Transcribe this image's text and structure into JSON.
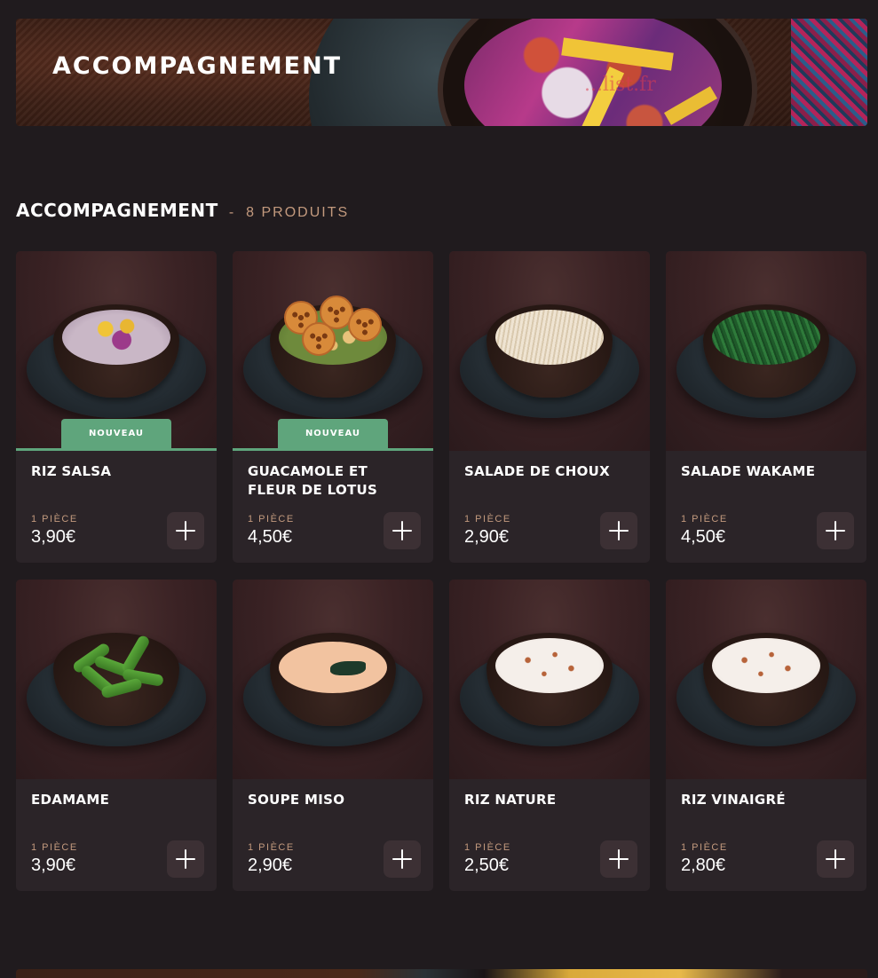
{
  "banner": {
    "title": "ACCOMPAGNEMENT",
    "watermark": "...list.fr"
  },
  "section": {
    "title": "ACCOMPAGNEMENT",
    "separator": "-",
    "count": "8 PRODUITS"
  },
  "colors": {
    "background": "#201b1e",
    "card": "#2b2428",
    "accent_green": "#5fa57c",
    "accent_tan": "#c39a7e",
    "button": "#3c3034"
  },
  "products": [
    {
      "name": "RIZ SALSA",
      "badge": "NOUVEAU",
      "unit": "1 PIÈCE",
      "price": "3,90€",
      "icon": "plus-icon"
    },
    {
      "name": "GUACAMOLE ET FLEUR DE LOTUS",
      "badge": "NOUVEAU",
      "unit": "1 PIÈCE",
      "price": "4,50€",
      "icon": "plus-icon"
    },
    {
      "name": "SALADE DE CHOUX",
      "unit": "1 PIÈCE",
      "price": "2,90€",
      "icon": "plus-icon"
    },
    {
      "name": "SALADE WAKAME",
      "unit": "1 PIÈCE",
      "price": "4,50€",
      "icon": "plus-icon"
    },
    {
      "name": "EDAMAME",
      "unit": "1 PIÈCE",
      "price": "3,90€",
      "icon": "plus-icon"
    },
    {
      "name": "SOUPE MISO",
      "unit": "1 PIÈCE",
      "price": "2,90€",
      "icon": "plus-icon"
    },
    {
      "name": "RIZ NATURE",
      "unit": "1 PIÈCE",
      "price": "2,50€",
      "icon": "plus-icon"
    },
    {
      "name": "RIZ VINAIGRÉ",
      "unit": "1 PIÈCE",
      "price": "2,80€",
      "icon": "plus-icon"
    }
  ]
}
